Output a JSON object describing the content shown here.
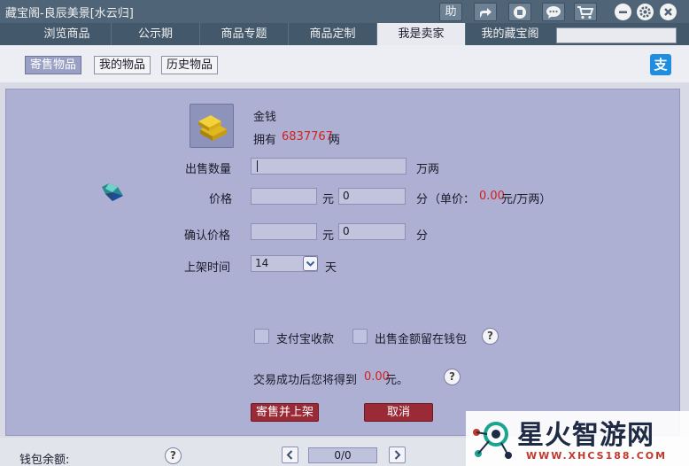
{
  "window": {
    "title": "藏宝阁-良辰美景[水云归]",
    "buttons": {
      "help_label": "助"
    }
  },
  "tabs": [
    {
      "label": "浏览商品",
      "active": false
    },
    {
      "label": "公示期",
      "active": false
    },
    {
      "label": "商品专题",
      "active": false
    },
    {
      "label": "商品定制",
      "active": false
    },
    {
      "label": "我是卖家",
      "active": true
    },
    {
      "label": "我的藏宝阁",
      "active": false
    }
  ],
  "search": {
    "value": "",
    "placeholder": ""
  },
  "subtabs": [
    {
      "label": "寄售物品",
      "active": true
    },
    {
      "label": "我的物品",
      "active": false
    },
    {
      "label": "历史物品",
      "active": false
    }
  ],
  "alipay_icon_char": "支",
  "item": {
    "name": "金钱",
    "own_prefix": "拥有",
    "own_amount": "6837767",
    "own_unit": "两"
  },
  "form": {
    "quantity_label": "出售数量",
    "quantity_value": "",
    "quantity_unit": "万两",
    "price_label": "价格",
    "price_yuan": "",
    "yuan_label": "元",
    "price_fen": "0",
    "fen_label": "分",
    "unit_price_prefix": "（单价：",
    "unit_price_value": "0.00",
    "unit_price_suffix": "元/万两）",
    "confirm_label": "确认价格",
    "confirm_yuan": "",
    "confirm_fen": "0",
    "listing_label": "上架时间",
    "listing_value": "14",
    "listing_unit": "天",
    "alipay_checkbox": "支付宝收款",
    "wallet_checkbox": "出售金额留在钱包",
    "receive_prefix": "交易成功后您将得到",
    "receive_amount": "0.00",
    "receive_suffix": "元。",
    "help_char": "?"
  },
  "actions": {
    "submit": "寄售并上架",
    "cancel": "取消"
  },
  "bottom": {
    "wallet_label": "钱包余额:",
    "page_display": "0/0"
  },
  "watermark": {
    "title": "星火智游网",
    "url": "WWW.XHCS188.COM"
  },
  "colors": {
    "accent_red": "#d42020",
    "panel": "#adb0d2",
    "titlebar": "#4f6477"
  }
}
